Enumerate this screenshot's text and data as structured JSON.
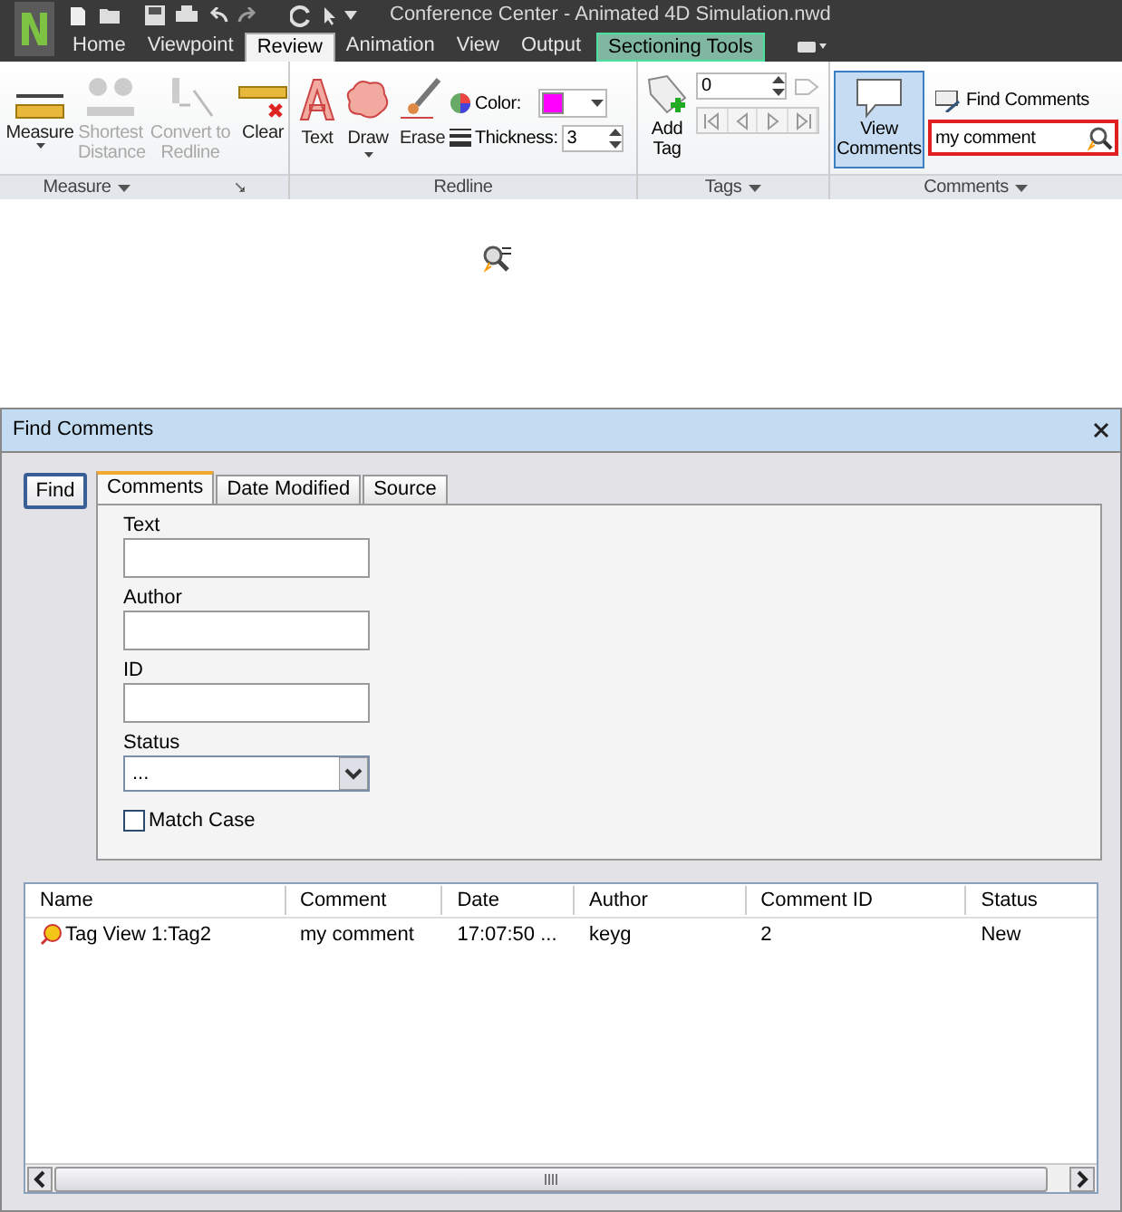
{
  "title_bar": {
    "title": "Conference Center - Animated 4D Simulation.nwd"
  },
  "ribbon_tabs": [
    {
      "label": "Home",
      "selected": false,
      "kind": "normal"
    },
    {
      "label": "Viewpoint",
      "selected": false,
      "kind": "normal"
    },
    {
      "label": "Review",
      "selected": true,
      "kind": "normal"
    },
    {
      "label": "Animation",
      "selected": false,
      "kind": "normal"
    },
    {
      "label": "View",
      "selected": false,
      "kind": "normal"
    },
    {
      "label": "Output",
      "selected": false,
      "kind": "normal"
    },
    {
      "label": "Sectioning Tools",
      "selected": false,
      "kind": "contextual"
    }
  ],
  "measure_group": {
    "label": "Measure",
    "buttons": [
      {
        "label": "Measure",
        "disabled": false
      },
      {
        "label": "Shortest Distance",
        "disabled": true
      },
      {
        "label": "Convert to Redline",
        "disabled": true
      },
      {
        "label": "Clear",
        "disabled": false
      }
    ]
  },
  "redline_group": {
    "label": "Redline",
    "buttons": [
      {
        "label": "Text"
      },
      {
        "label": "Draw"
      },
      {
        "label": "Erase"
      }
    ],
    "color_label": "Color:",
    "color": "#ff00ff",
    "thickness_label": "Thickness:",
    "thickness_value": "3"
  },
  "tags_group": {
    "label": "Tags",
    "add_tag": "Add Tag",
    "tag_number": "0"
  },
  "comments_group": {
    "label": "Comments",
    "view_comments": {
      "label": "View Comments",
      "selected": true
    },
    "find_comments": "Find Comments",
    "search_value": "my comment"
  },
  "dialog": {
    "title": "Find Comments",
    "find_button": "Find",
    "tabs": [
      {
        "label": "Comments",
        "selected": true
      },
      {
        "label": "Date Modified",
        "selected": false
      },
      {
        "label": "Source",
        "selected": false
      }
    ],
    "fields": [
      {
        "label": "Text"
      },
      {
        "label": "Author"
      },
      {
        "label": "ID"
      }
    ],
    "status": {
      "label": "Status",
      "value": "..."
    },
    "match_case": {
      "label": "Match Case",
      "checked": false
    },
    "columns": [
      "Name",
      "Comment",
      "Date",
      "Author",
      "Comment ID",
      "Status"
    ],
    "rows": [
      {
        "cells": [
          "Tag View 1:Tag2",
          "my comment",
          "17:07:50 ...",
          "keyg",
          "2",
          "New"
        ]
      }
    ]
  }
}
